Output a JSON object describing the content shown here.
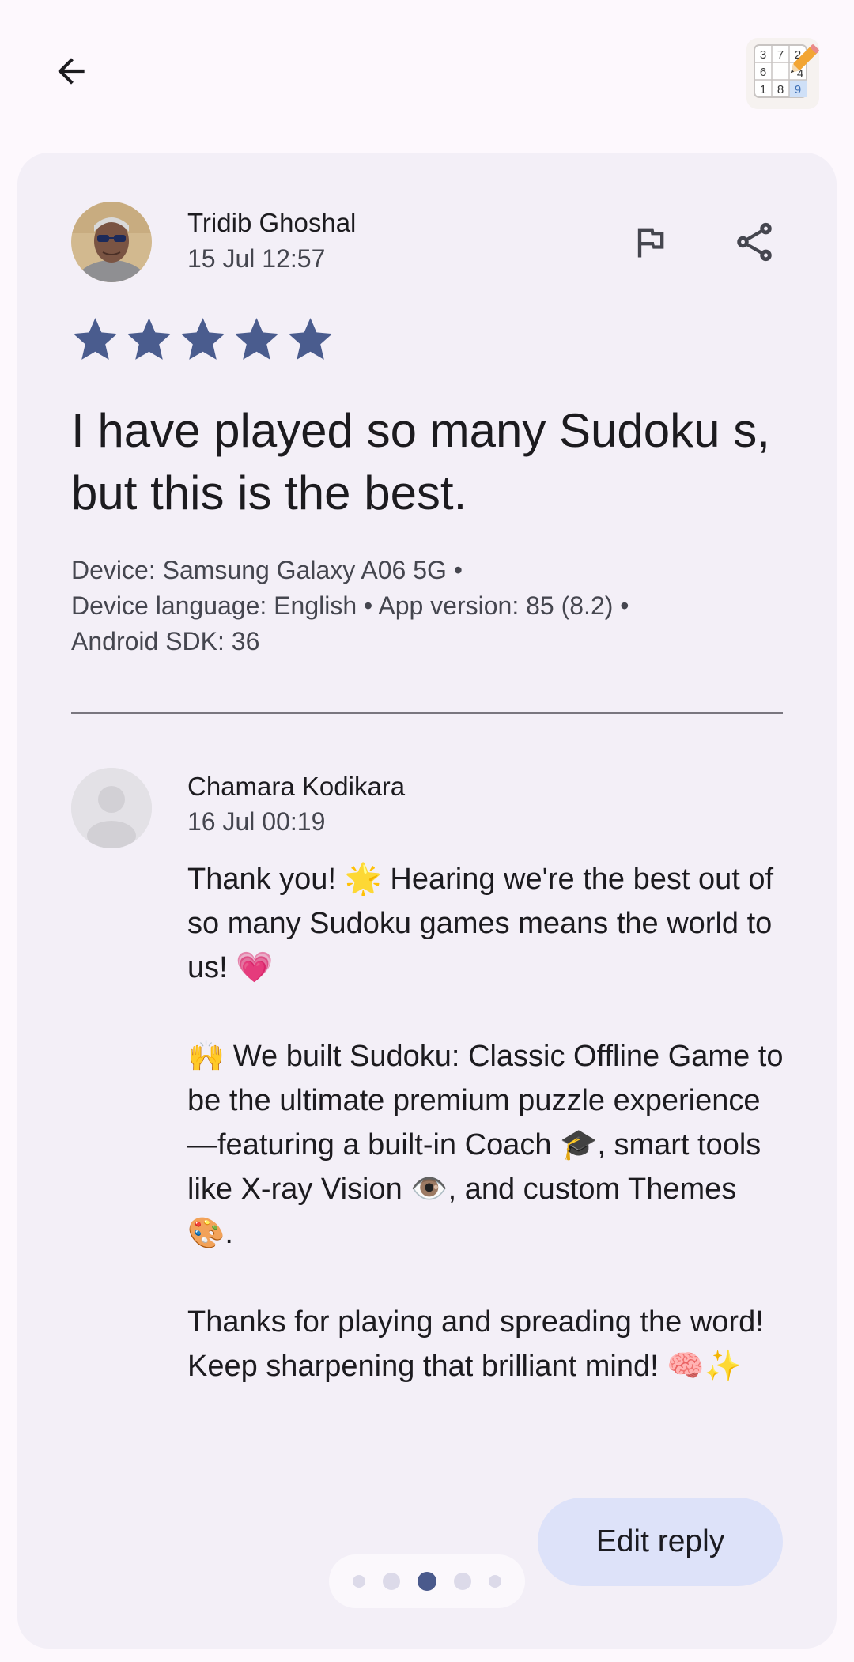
{
  "review": {
    "author": "Tridib Ghoshal",
    "date": "15 Jul 12:57",
    "rating": 5,
    "max_rating": 5,
    "text": "I have played so many Sudoku s, but this is the best.",
    "device_info": "Device: Samsung Galaxy A06 5G •\nDevice language: English • App version: 85 (8.2) •\nAndroid SDK: 36"
  },
  "reply": {
    "author": "Chamara Kodikara",
    "date": "16 Jul 00:19",
    "paragraphs": [
      "Thank you! 🌟 Hearing we're the best out of so many Sudoku games means the world to us! 💗",
      "🙌 We built Sudoku: Classic Offline Game to be the ultimate premium puzzle experience—featuring a built-in Coach 🎓, smart tools like X-ray Vision 👁️, and custom Themes 🎨.",
      "Thanks for playing and spreading the word! Keep sharpening that brilliant mind! 🧠✨"
    ],
    "edit_label": "Edit reply"
  },
  "app_icon": {
    "digits": [
      "3",
      "7",
      "2",
      "6",
      "",
      "4",
      "1",
      "8",
      "9"
    ],
    "icon_name": "sudoku-pencil-icon"
  },
  "pager": {
    "count": 5,
    "active_index": 2
  },
  "colors": {
    "star": "#4a5c8e",
    "accent_button": "#dde2f9",
    "card_background": "#f3eff7",
    "page_background": "#fdf8fd"
  }
}
